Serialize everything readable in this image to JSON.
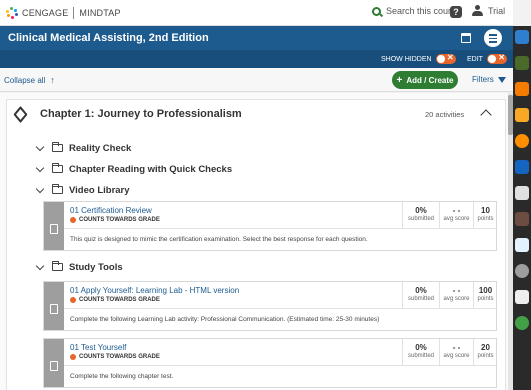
{
  "header": {
    "brand": "CENGAGE",
    "product": "MINDTAP",
    "search_label": "Search this course",
    "help_label": "?",
    "user_label": "Trial"
  },
  "course": {
    "title": "Clinical Medical Assisting, 2nd Edition"
  },
  "toggles": {
    "show_hidden": "SHOW HIDDEN",
    "edit": "EDIT",
    "off_glyph": "✕"
  },
  "actions": {
    "collapse_all": "Collapse all",
    "collapse_arrow": "↑",
    "add_create": "Add / Create",
    "add_plus": "+",
    "filters": "Filters"
  },
  "chapter": {
    "title": "Chapter 1: Journey to Professionalism",
    "count": "20 activities",
    "folders": [
      {
        "label": "Reality Check"
      },
      {
        "label": "Chapter Reading with Quick Checks"
      },
      {
        "label": "Video Library"
      },
      {
        "label": "Study Tools"
      }
    ],
    "activities": [
      {
        "name": "01 Certification Review",
        "grade_label": "COUNTS TOWARDS GRADE",
        "submitted_value": "0%",
        "submitted_label": "submitted",
        "avg_value": "- -",
        "avg_label": "avg score",
        "points_value": "10",
        "points_label": "points",
        "description": "This quiz is designed to mimic the certification examination. Select the best response for each question."
      },
      {
        "name": "01 Apply Yourself: Learning Lab - HTML version",
        "grade_label": "COUNTS TOWARDS GRADE",
        "submitted_value": "0%",
        "submitted_label": "submitted",
        "avg_value": "- -",
        "avg_label": "avg score",
        "points_value": "100",
        "points_label": "points",
        "description": "Complete the following Learning Lab activity: Professional Communication. (Estimated time: 25-30 minutes)"
      },
      {
        "name": "01 Test Yourself",
        "grade_label": "COUNTS TOWARDS GRADE",
        "submitted_value": "0%",
        "submitted_label": "submitted",
        "avg_value": "- -",
        "avg_label": "avg score",
        "points_value": "20",
        "points_label": "points",
        "description": "Complete the following chapter test."
      }
    ]
  },
  "colors": {
    "course_bar": "#1d5b8f",
    "toggle_bar": "#184e7c",
    "accent_green": "#2e7d32",
    "toggle_orange": "#e8662c",
    "grade_dot": "#e8662c"
  },
  "icons": {
    "logo": "cengage-logo-icon",
    "search": "search-icon",
    "help": "help-icon",
    "user": "user-icon",
    "calendar": "calendar-icon",
    "outline": "list-view-icon",
    "chapter": "cube-icon",
    "folder": "folder-icon",
    "activity": "document-icon",
    "filter": "funnel-icon"
  }
}
